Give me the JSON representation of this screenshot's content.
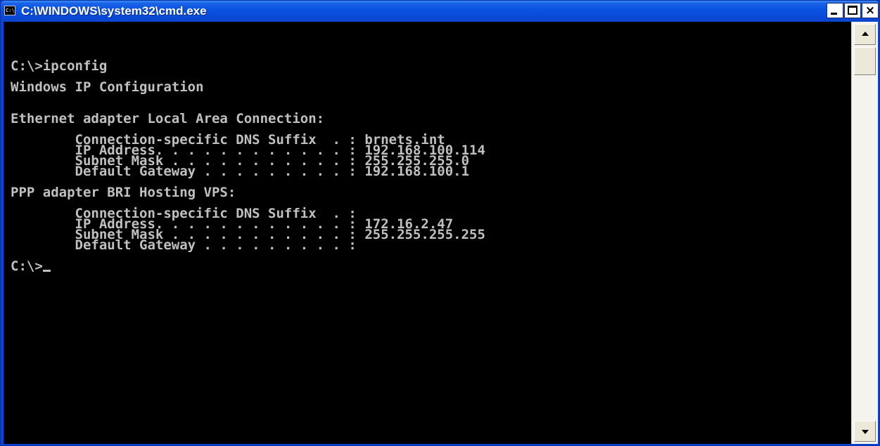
{
  "window": {
    "title": "C:\\WINDOWS\\system32\\cmd.exe",
    "icon_label": "C:\\",
    "colors": {
      "titlebar": "#0a53e2",
      "console_bg": "#000000",
      "console_text": "#c0c0c0"
    }
  },
  "title_buttons": {
    "minimize_icon": "minimize-icon",
    "maximize_icon": "maximize-icon",
    "close_glyph": "×"
  },
  "console": {
    "lines": [
      "C:\\>ipconfig",
      "",
      "Windows IP Configuration",
      "",
      "",
      "Ethernet adapter Local Area Connection:",
      "",
      "        Connection-specific DNS Suffix  . : brnets.int",
      "        IP Address. . . . . . . . . . . . : 192.168.100.114",
      "        Subnet Mask . . . . . . . . . . . : 255.255.255.0",
      "        Default Gateway . . . . . . . . . : 192.168.100.1",
      "",
      "PPP adapter BRI Hosting VPS:",
      "",
      "        Connection-specific DNS Suffix  . :",
      "        IP Address. . . . . . . . . . . . : 172.16.2.47",
      "        Subnet Mask . . . . . . . . . . . : 255.255.255.255",
      "        Default Gateway . . . . . . . . . :",
      "",
      "C:\\>"
    ]
  },
  "scrollbar": {
    "up_icon": "scroll-up-arrow-icon",
    "down_icon": "scroll-down-arrow-icon"
  }
}
